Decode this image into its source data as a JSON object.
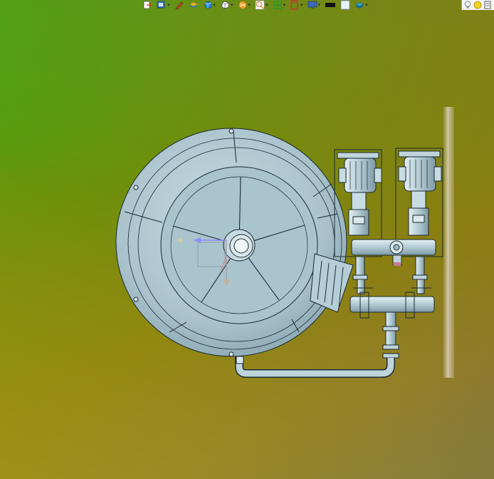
{
  "app": {
    "name": "3D CAD viewport"
  },
  "toolbar": {
    "buttons": [
      {
        "name": "exit-icon",
        "color": "#d04a1a",
        "dropdown": false
      },
      {
        "name": "view-mode-icon",
        "color": "#3a78c8",
        "dropdown": true
      },
      {
        "name": "sketch-pencil-icon",
        "color": "#c84a2a",
        "dropdown": false
      },
      {
        "name": "layer-stack-icon",
        "color": "#e0b020",
        "dropdown": false
      },
      {
        "name": "cube-view-icon",
        "color": "#2a88d8",
        "dropdown": true
      },
      {
        "name": "wireframe-cube-icon",
        "color": "#ffffff",
        "dropdown": true
      },
      {
        "name": "render-sphere-icon",
        "color": "#f0a020",
        "dropdown": true
      },
      {
        "name": "zoom-fit-icon",
        "color": "#e08030",
        "dropdown": true
      },
      {
        "name": "green-frame-icon",
        "color": "#2a9a2a",
        "dropdown": true
      },
      {
        "name": "red-frame-icon",
        "color": "#d03030",
        "dropdown": true
      },
      {
        "name": "monitor-icon",
        "color": "#3a6ab8",
        "dropdown": true
      },
      {
        "name": "black-swatch-icon",
        "color": "#101010",
        "dropdown": false
      },
      {
        "name": "white-square-icon",
        "color": "#e8f4fc",
        "dropdown": false
      },
      {
        "name": "layers-icon",
        "color": "#30a0c0",
        "dropdown": true
      }
    ],
    "light_panel": {
      "icons": [
        "lightbulb-icon",
        "yellow-light-icon",
        "light-settings-icon"
      ]
    }
  },
  "model": {
    "tank_fill": "#b5cdd6",
    "line_color": "#1a2a30",
    "axis_colors": {
      "x": "#8c8cff",
      "y": "#e09090",
      "z": "#a0a0a0"
    }
  }
}
